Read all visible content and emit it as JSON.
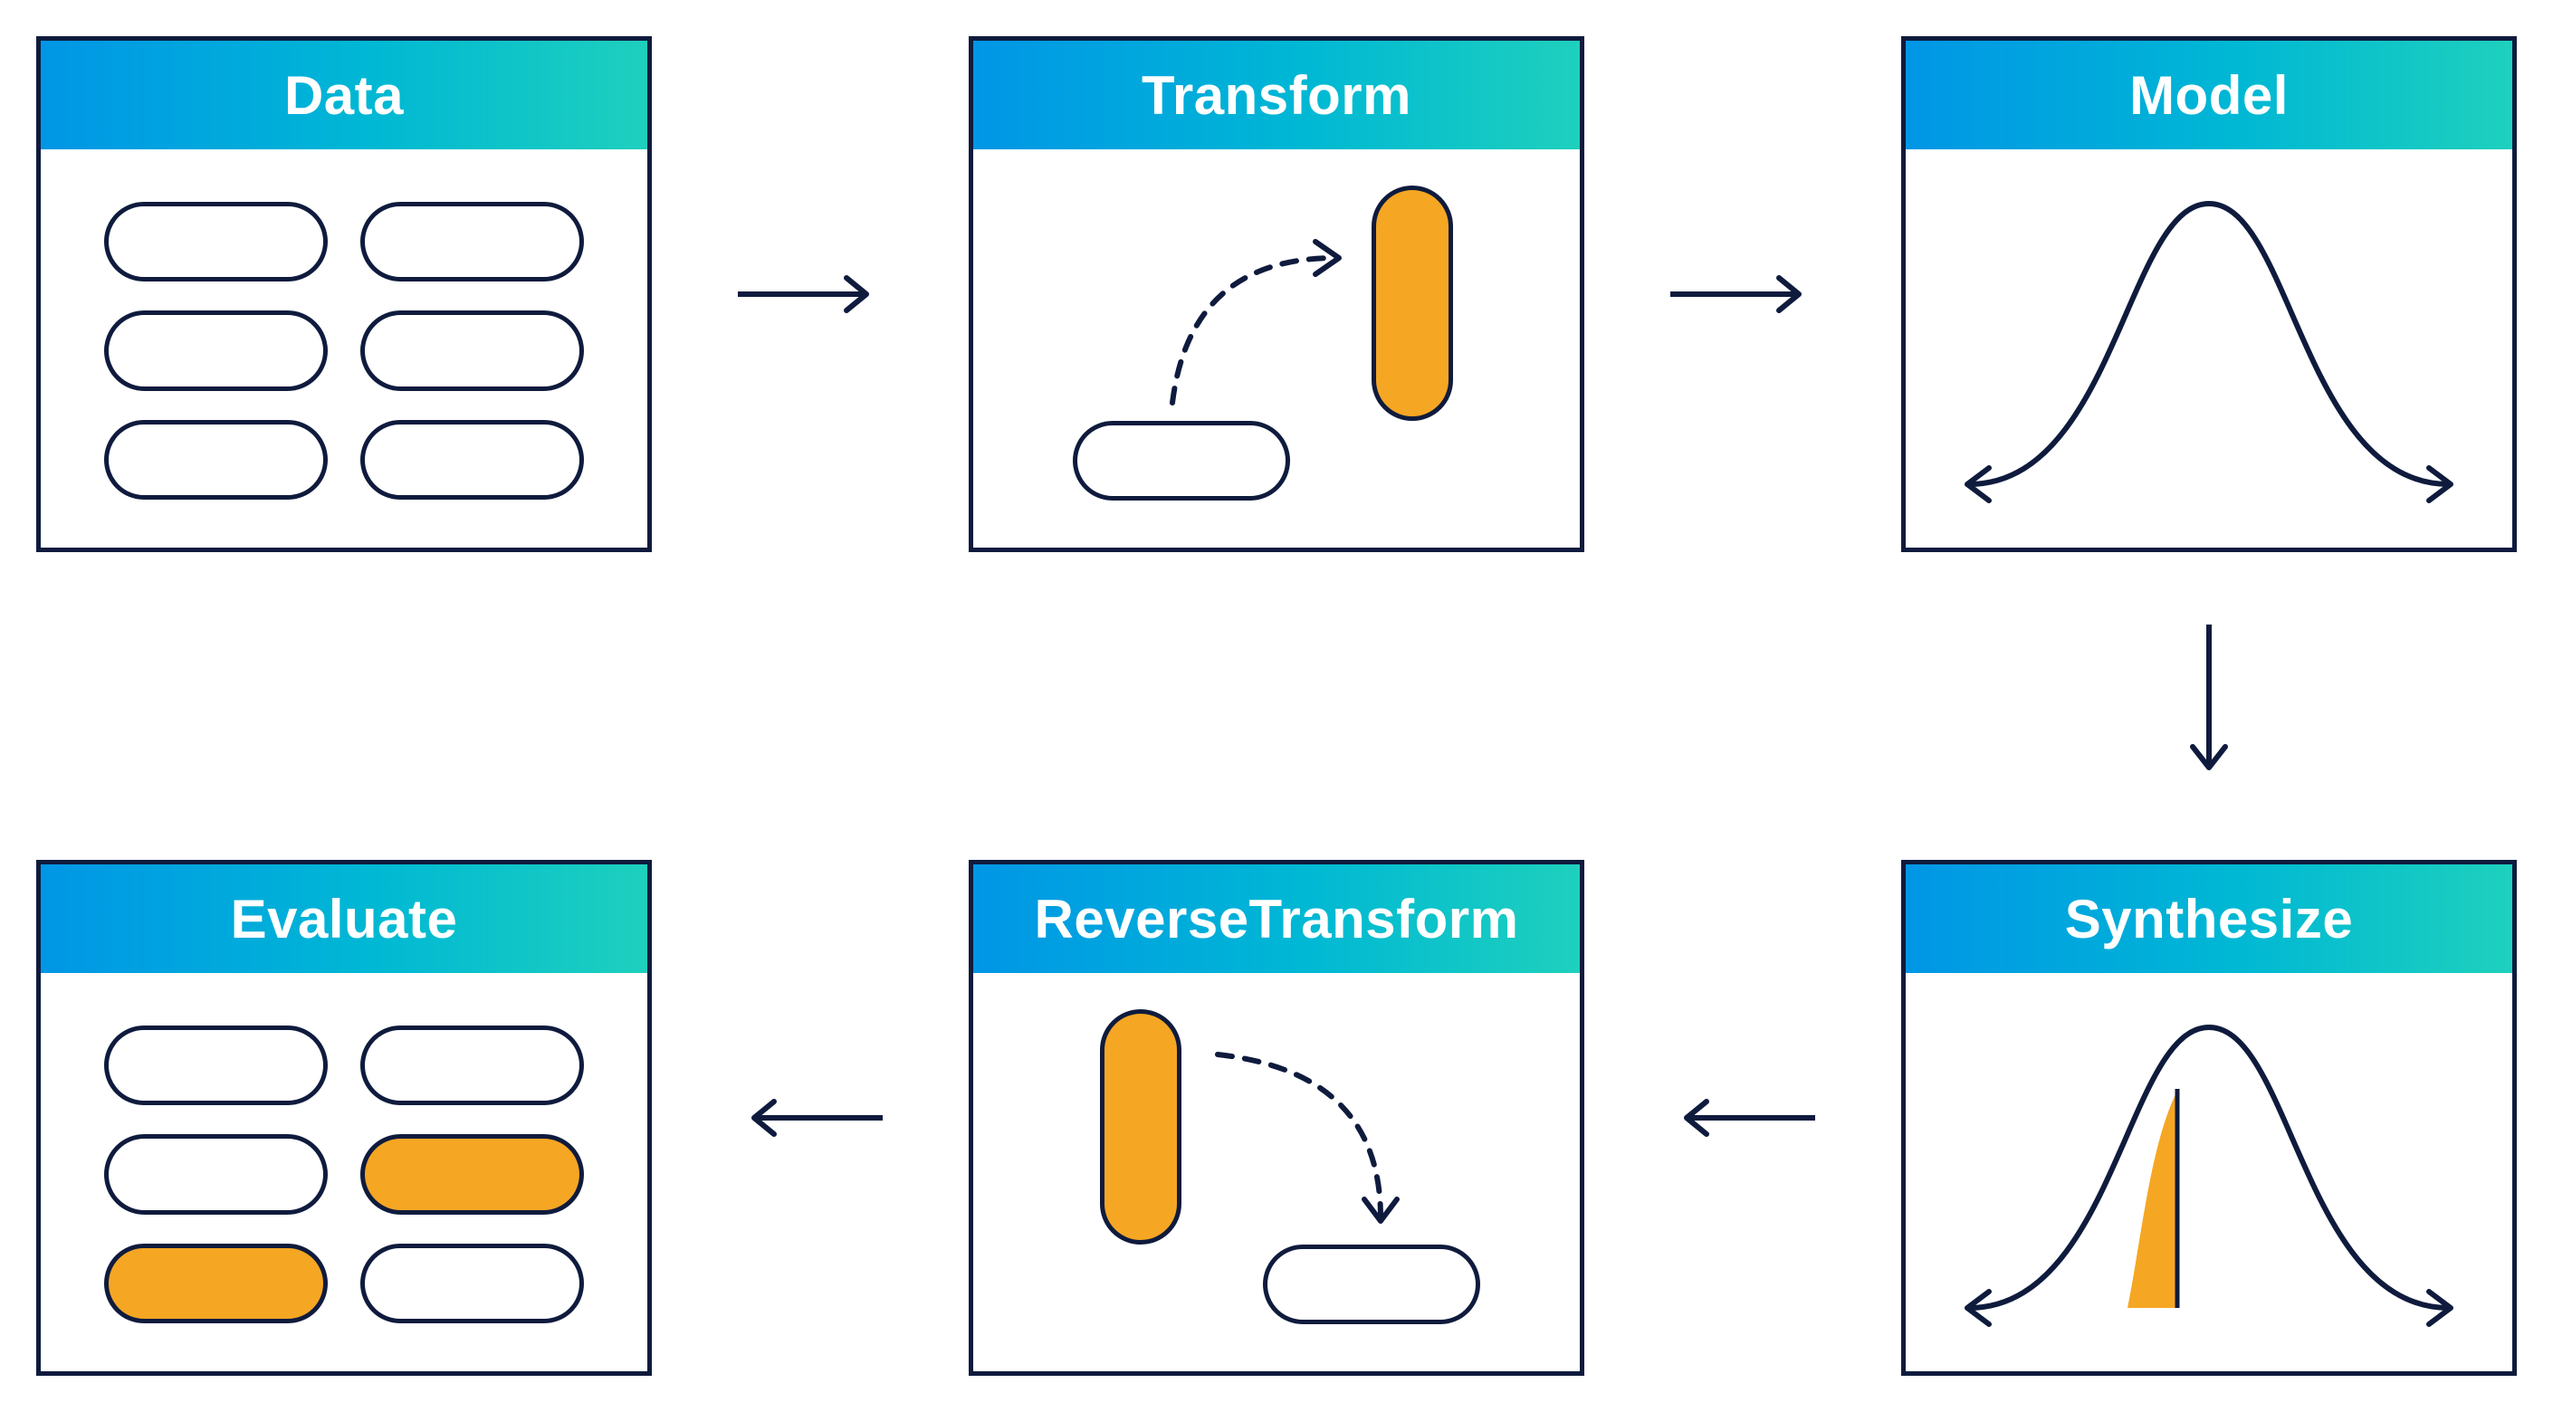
{
  "colors": {
    "stroke": "#0f1b3d",
    "orange": "#f5a623",
    "gradient_start": "#0096e6",
    "gradient_mid": "#00b8d4",
    "gradient_end": "#1ed0bd"
  },
  "cards": {
    "data": {
      "title": "Data"
    },
    "transform": {
      "title": "Transform"
    },
    "model": {
      "title": "Model"
    },
    "synthesize": {
      "title": "Synthesize"
    },
    "reverse_transform": {
      "title": "ReverseTransform"
    },
    "evaluate": {
      "title": "Evaluate"
    }
  },
  "flow": [
    "data",
    "transform",
    "model",
    "synthesize",
    "reverse_transform",
    "evaluate"
  ]
}
